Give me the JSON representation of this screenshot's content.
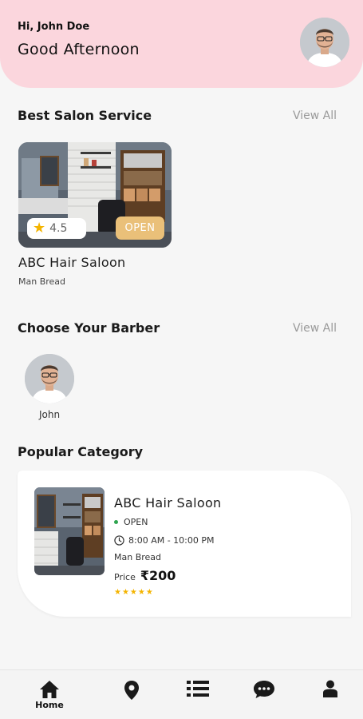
{
  "header": {
    "greeting": "Hi, John Doe",
    "time_greeting": "Good Afternoon"
  },
  "best_salon": {
    "title": "Best Salon Service",
    "view_all": "View All",
    "card": {
      "rating": "4.5",
      "status": "OPEN",
      "name": "ABC Hair Saloon",
      "subtitle": "Man Bread"
    }
  },
  "barbers": {
    "title": "Choose Your Barber",
    "view_all": "View All",
    "items": [
      {
        "name": "John"
      }
    ]
  },
  "popular": {
    "title": "Popular Category",
    "card": {
      "name": "ABC Hair Saloon",
      "status": "OPEN",
      "hours": "8:00 AM - 10:00 PM",
      "subtitle": "Man Bread",
      "price_label": "Price",
      "price": "₹200",
      "stars": "★★★★★"
    }
  },
  "nav": {
    "items": [
      {
        "label": "Home",
        "icon": "home-icon"
      },
      {
        "label": "",
        "icon": "location-pin-icon"
      },
      {
        "label": "",
        "icon": "list-icon"
      },
      {
        "label": "",
        "icon": "chat-icon"
      },
      {
        "label": "",
        "icon": "profile-icon"
      }
    ]
  },
  "colors": {
    "header_bg": "#fbd6dd",
    "open_badge": "#eac079",
    "star": "#f4b400",
    "status_dot": "#2ea44f"
  }
}
